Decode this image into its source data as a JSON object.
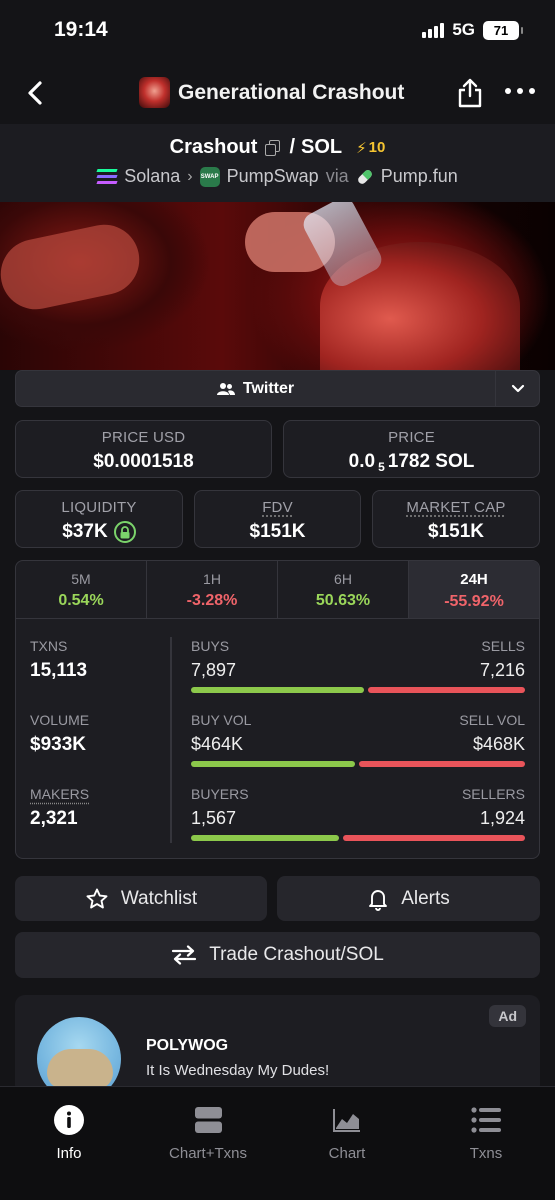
{
  "status_bar": {
    "time": "19:14",
    "network": "5G",
    "battery": "71"
  },
  "header": {
    "title": "Generational Crashout"
  },
  "pair": {
    "base": "Crashout",
    "separator": "/",
    "quote": "SOL",
    "boost": "10",
    "chain": "Solana",
    "dex": "PumpSwap",
    "via": "via",
    "launchpad": "Pump.fun"
  },
  "social": {
    "twitter_label": "Twitter"
  },
  "stats": {
    "price_usd_label": "PRICE USD",
    "price_usd": "$0.0001518",
    "price_label": "PRICE",
    "price_prefix": "0.0",
    "price_zeros": "5",
    "price_suffix": "1782 SOL",
    "liquidity_label": "LIQUIDITY",
    "liquidity": "$37K",
    "fdv_label": "FDV",
    "fdv": "$151K",
    "mcap_label": "MARKET CAP",
    "mcap": "$151K"
  },
  "timeframes": [
    {
      "label": "5M",
      "value": "0.54%"
    },
    {
      "label": "1H",
      "value": "-3.28%"
    },
    {
      "label": "6H",
      "value": "50.63%"
    },
    {
      "label": "24H",
      "value": "-55.92%"
    }
  ],
  "activity": {
    "txns_label": "TXNS",
    "txns": "15,113",
    "volume_label": "VOLUME",
    "volume": "$933K",
    "makers_label": "MAKERS",
    "makers": "2,321",
    "buys_label": "BUYS",
    "buys": "7,897",
    "sells_label": "SELLS",
    "sells": "7,216",
    "buys_ratio": 0.5225,
    "buy_vol_label": "BUY VOL",
    "buy_vol": "$464K",
    "sell_vol_label": "SELL VOL",
    "sell_vol": "$468K",
    "vol_ratio": 0.4978,
    "buyers_label": "BUYERS",
    "buyers": "1,567",
    "sellers_label": "SELLERS",
    "sellers": "1,924",
    "buyers_ratio": 0.4489
  },
  "actions": {
    "watchlist": "Watchlist",
    "alerts": "Alerts",
    "trade": "Trade Crashout/SOL"
  },
  "ad": {
    "badge": "Ad",
    "title": "POLYWOG",
    "subtitle": "It Is Wednesday My Dudes!"
  },
  "tabs": [
    {
      "label": "Info",
      "icon": "info-icon"
    },
    {
      "label": "Chart+Txns",
      "icon": "split-panel-icon"
    },
    {
      "label": "Chart",
      "icon": "area-chart-icon"
    },
    {
      "label": "Txns",
      "icon": "list-icon"
    }
  ],
  "colors": {
    "positive": "#9ad65a",
    "negative": "#f0646a",
    "boost": "#f5c431",
    "buy_bar": "#8cc84b",
    "sell_bar": "#e9545a"
  }
}
